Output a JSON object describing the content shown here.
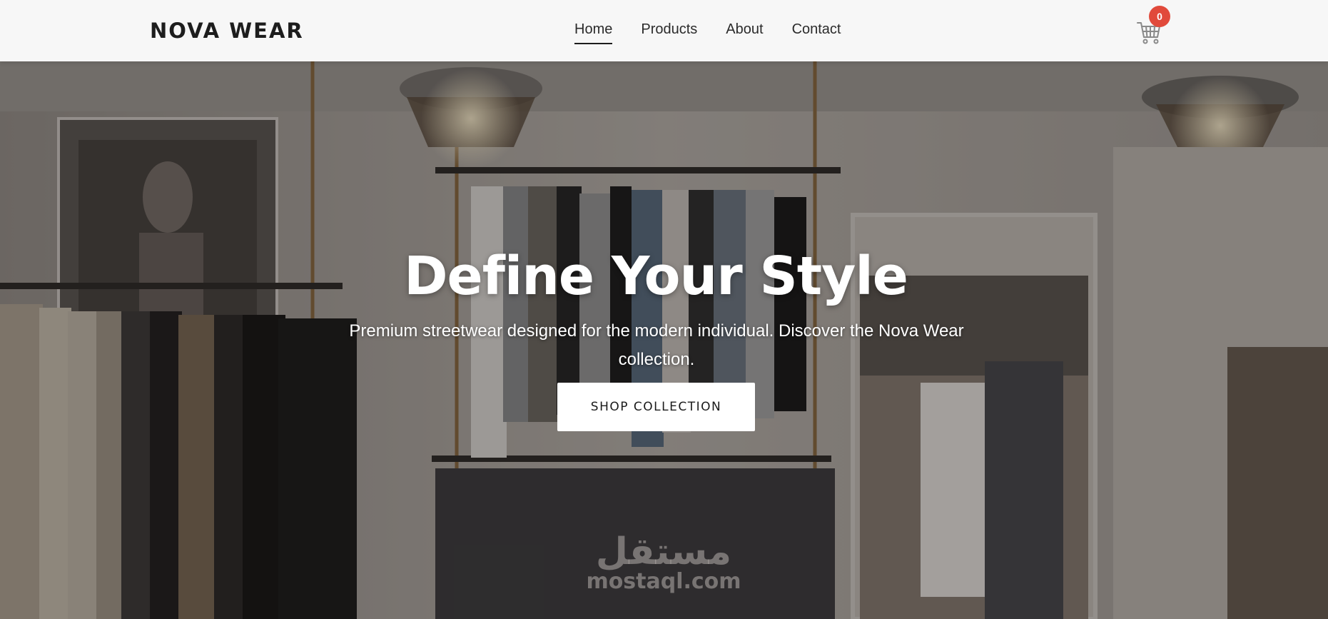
{
  "brand": {
    "name": "NOVA WEAR"
  },
  "nav": {
    "items": [
      {
        "label": "Home",
        "active": true
      },
      {
        "label": "Products",
        "active": false
      },
      {
        "label": "About",
        "active": false
      },
      {
        "label": "Contact",
        "active": false
      }
    ]
  },
  "cart": {
    "icon": "cart-icon",
    "count": "0",
    "badge_color": "#e14a3b"
  },
  "hero": {
    "title": "Define Your Style",
    "subtitle": "Premium streetwear designed for the modern individual. Discover the Nova Wear collection.",
    "cta_label": "SHOP COLLECTION"
  },
  "watermark": {
    "arabic": "مستقل",
    "text": "mostaql.com"
  }
}
